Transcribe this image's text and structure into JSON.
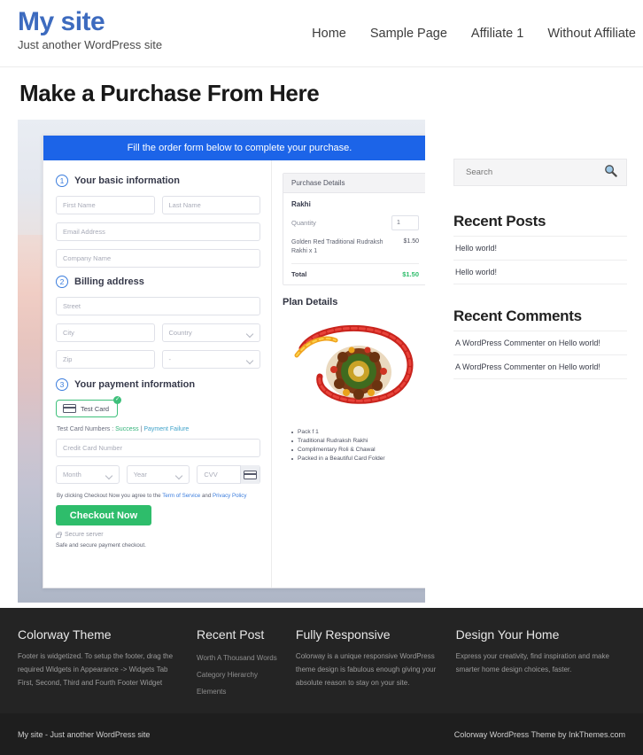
{
  "header": {
    "brand_title": "My site",
    "brand_tagline": "Just another WordPress site",
    "nav": [
      {
        "label": "Home"
      },
      {
        "label": "Sample Page"
      },
      {
        "label": "Affiliate 1"
      },
      {
        "label": "Without Affiliate"
      }
    ]
  },
  "main": {
    "page_title": "Make a Purchase From Here",
    "form": {
      "banner": "Fill the order form below to complete your purchase.",
      "steps": [
        {
          "num": "1",
          "label": "Your basic information"
        },
        {
          "num": "2",
          "label": "Billing address"
        },
        {
          "num": "3",
          "label": "Your payment information"
        }
      ],
      "fields": {
        "first_name": "First Name",
        "last_name": "Last Name",
        "email": "Email Address",
        "company": "Company Name",
        "street": "Street",
        "city": "City",
        "country": "Country",
        "zip": "Zip",
        "state": "-",
        "credit_card": "Credit Card Number",
        "month": "Month",
        "year": "Year",
        "cvv": "CVV"
      },
      "payment": {
        "card_option_label": "Test Card",
        "test_numbers_prefix": "Test Card Numbers : ",
        "test_success": "Success",
        "test_divider": " | ",
        "test_failure": "Payment Failure",
        "terms_prefix": "By clicking Checkout Now you agree to the ",
        "terms_link": "Term of Service",
        "terms_mid": " and ",
        "privacy_link": "Privacy Policy",
        "checkout_label": "Checkout Now",
        "secure_server": "Secure server",
        "safe_note": "Safe and secure payment checkout."
      },
      "purchase_details": {
        "heading": "Purchase Details",
        "product": "Rakhi",
        "quantity_label": "Quantity",
        "quantity_value": "1",
        "line_item_name": "Golden Red Traditional Rudraksh Rakhi x 1",
        "line_item_price": "$1.50",
        "total_label": "Total",
        "total_value": "$1.50"
      },
      "plan": {
        "title": "Plan Details",
        "bullets": [
          "Pack f 1",
          "Traditional Rudraksh Rakhi",
          "Complimentary Roli & Chawal",
          "Packed in a Beautiful Card Folder"
        ]
      }
    }
  },
  "sidebar": {
    "search": {
      "value": "Search",
      "placeholder": "Search"
    },
    "widgets": [
      {
        "title": "Recent Posts",
        "items": [
          "Hello world!",
          "Hello world!"
        ]
      },
      {
        "title": "Recent Comments",
        "items": [
          "A WordPress Commenter on Hello world!",
          "A WordPress Commenter on Hello world!"
        ]
      }
    ]
  },
  "footer": {
    "columns": [
      {
        "title": "Colorway Theme",
        "text": "Footer is widgetized. To setup the footer, drag the required Widgets in Appearance -> Widgets Tab First, Second, Third and Fourth Footer Widget"
      },
      {
        "title": "Recent Post",
        "items": [
          "Worth A Thousand Words",
          "Category Hierarchy",
          "Elements"
        ]
      },
      {
        "title": "Fully Responsive",
        "text": "Colorway is a unique responsive WordPress theme design is fabulous enough giving your absolute reason to stay on your site."
      },
      {
        "title": "Design Your Home",
        "text": "Express your creativity, find inspiration and make smarter home design choices, faster."
      }
    ],
    "copyright_left": "My site - Just another WordPress site",
    "copyright_right": "Colorway WordPress Theme by InkThemes.com"
  },
  "colors": {
    "brand": "#3d6bbf",
    "banner": "#1c64e8",
    "accent_green": "#2ebd6b",
    "link_blue": "#3b7ddd",
    "footer_bg": "#242424"
  }
}
